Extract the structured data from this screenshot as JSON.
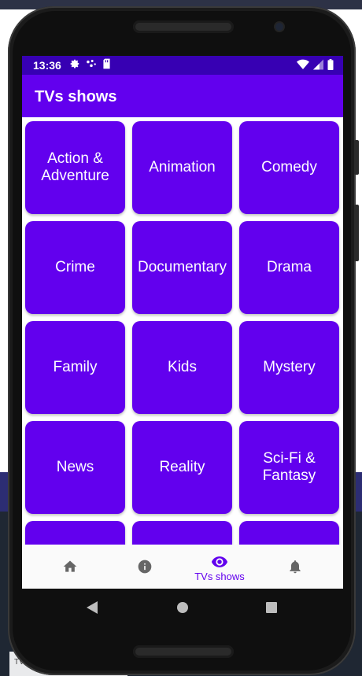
{
  "status_bar": {
    "time": "13:36",
    "left_icons": [
      "gear-icon",
      "dots-icon",
      "sim-card-icon"
    ],
    "right_icons": [
      "wifi-icon",
      "signal-icon",
      "battery-icon"
    ]
  },
  "app_bar": {
    "title": "TVs shows"
  },
  "genres": [
    "Action &\nAdventure",
    "Animation",
    "Comedy",
    "Crime",
    "Documentary",
    "Drama",
    "Family",
    "Kids",
    "Mystery",
    "News",
    "Reality",
    "Sci-Fi &\nFantasy",
    "",
    "",
    ""
  ],
  "bottom_nav": {
    "items": [
      {
        "icon": "home-icon",
        "label": ""
      },
      {
        "icon": "info-icon",
        "label": ""
      },
      {
        "icon": "eye-icon",
        "label": "TVs shows",
        "selected": true
      },
      {
        "icon": "bell-icon",
        "label": ""
      }
    ]
  },
  "colors": {
    "primary": "#6200ee",
    "primary_dark": "#3700b3",
    "nav_inactive": "#666666"
  },
  "background": {
    "tab_text": "TV"
  }
}
